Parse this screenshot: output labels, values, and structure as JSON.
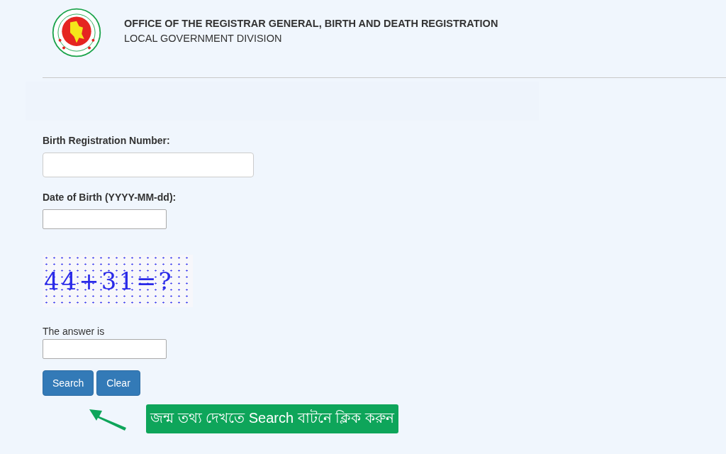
{
  "header": {
    "title": "OFFICE OF THE REGISTRAR GENERAL, BIRTH AND DEATH REGISTRATION",
    "subtitle": "LOCAL GOVERNMENT DIVISION"
  },
  "form": {
    "fields": [
      {
        "label": "Birth Registration Number:",
        "kind": "wide"
      },
      {
        "label": "Date of Birth (YYYY-MM-dd):",
        "kind": "narrow"
      }
    ],
    "captcha": {
      "text": "44+31=?"
    },
    "answer": {
      "label": "The answer is"
    },
    "buttons": [
      "Search",
      "Clear"
    ]
  },
  "callout": {
    "text": "জন্ম তথ্য দেখতে Search বাটনে ক্লিক করুন"
  }
}
